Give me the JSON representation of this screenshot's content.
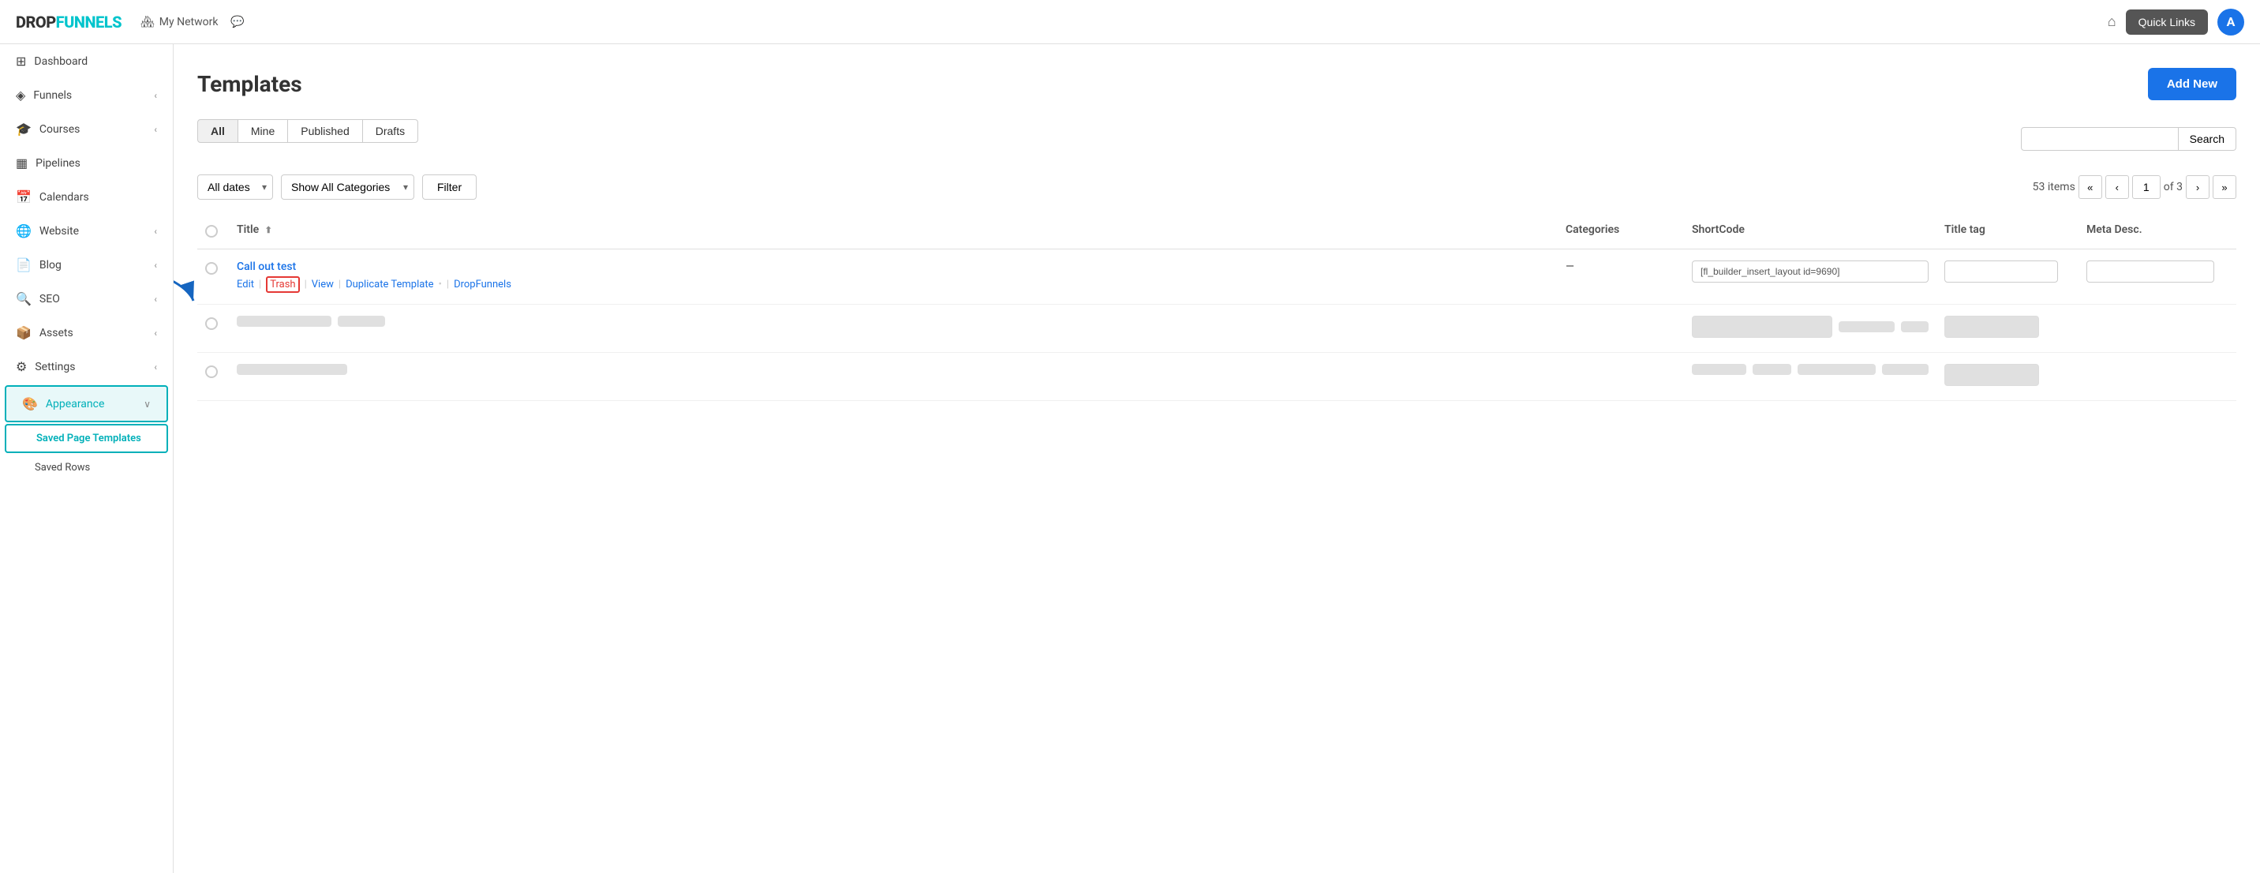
{
  "brand": {
    "drop": "DROP",
    "funnels": "FUNNELS"
  },
  "topnav": {
    "my_network": "My Network",
    "quick_links": "Quick Links",
    "avatar_letter": "A",
    "home_symbol": "⌂",
    "message_symbol": "💬"
  },
  "sidebar": {
    "items": [
      {
        "id": "dashboard",
        "label": "Dashboard",
        "icon": "⊞",
        "has_chevron": false
      },
      {
        "id": "funnels",
        "label": "Funnels",
        "icon": "⬡",
        "has_chevron": true
      },
      {
        "id": "courses",
        "label": "Courses",
        "icon": "🎓",
        "has_chevron": true
      },
      {
        "id": "pipelines",
        "label": "Pipelines",
        "icon": "▦",
        "has_chevron": false
      },
      {
        "id": "calendars",
        "label": "Calendars",
        "icon": "📅",
        "has_chevron": false
      },
      {
        "id": "website",
        "label": "Website",
        "icon": "🌐",
        "has_chevron": true
      },
      {
        "id": "blog",
        "label": "Blog",
        "icon": "📰",
        "has_chevron": true
      },
      {
        "id": "seo",
        "label": "SEO",
        "icon": "🔍",
        "has_chevron": true
      },
      {
        "id": "assets",
        "label": "Assets",
        "icon": "📦",
        "has_chevron": true
      },
      {
        "id": "settings",
        "label": "Settings",
        "icon": "⚙",
        "has_chevron": true
      },
      {
        "id": "appearance",
        "label": "Appearance",
        "icon": "🎨",
        "has_chevron": true,
        "active": true
      }
    ],
    "sub_items": [
      {
        "id": "saved-page-templates",
        "label": "Saved Page Templates",
        "selected": true
      },
      {
        "id": "saved-rows",
        "label": "Saved Rows"
      }
    ]
  },
  "main": {
    "title": "Templates",
    "add_new_label": "Add New",
    "tabs": [
      {
        "id": "all",
        "label": "All"
      },
      {
        "id": "mine",
        "label": "Mine"
      },
      {
        "id": "published",
        "label": "Published"
      },
      {
        "id": "drafts",
        "label": "Drafts"
      }
    ],
    "active_tab": "all",
    "search_placeholder": "",
    "search_btn_label": "Search",
    "filter_row": {
      "dates_label": "All dates",
      "categories_label": "Show All Categories",
      "filter_label": "Filter"
    },
    "pagination": {
      "items_count": "53 items",
      "current_page": "1",
      "total_pages": "of 3",
      "first": "«",
      "prev": "‹",
      "next": "›",
      "last": "»"
    },
    "table": {
      "columns": [
        "",
        "Title",
        "Categories",
        "ShortCode",
        "Title tag",
        "Meta Desc."
      ],
      "rows": [
        {
          "id": "row1",
          "title": "Call out test",
          "categories": "—",
          "shortcode": "[fl_builder_insert_layout id=9690]",
          "title_tag": "",
          "meta_desc": "",
          "actions": [
            "Edit",
            "Trash",
            "View",
            "Duplicate Template",
            "DropFunnels"
          ],
          "blurred": false
        },
        {
          "id": "row2",
          "title": "",
          "categories": "",
          "shortcode": "",
          "title_tag": "",
          "meta_desc": "",
          "blurred": true,
          "blurred_title_w": 120,
          "blurred_shortcode_w": 200,
          "blurred_extras": [
            80,
            40
          ]
        },
        {
          "id": "row3",
          "title": "",
          "categories": "",
          "shortcode": "",
          "title_tag": "",
          "meta_desc": "",
          "blurred": true,
          "blurred_title_w": 140,
          "blurred_shortcode_w": 220,
          "blurred_extras": [
            70,
            50
          ]
        }
      ]
    }
  }
}
